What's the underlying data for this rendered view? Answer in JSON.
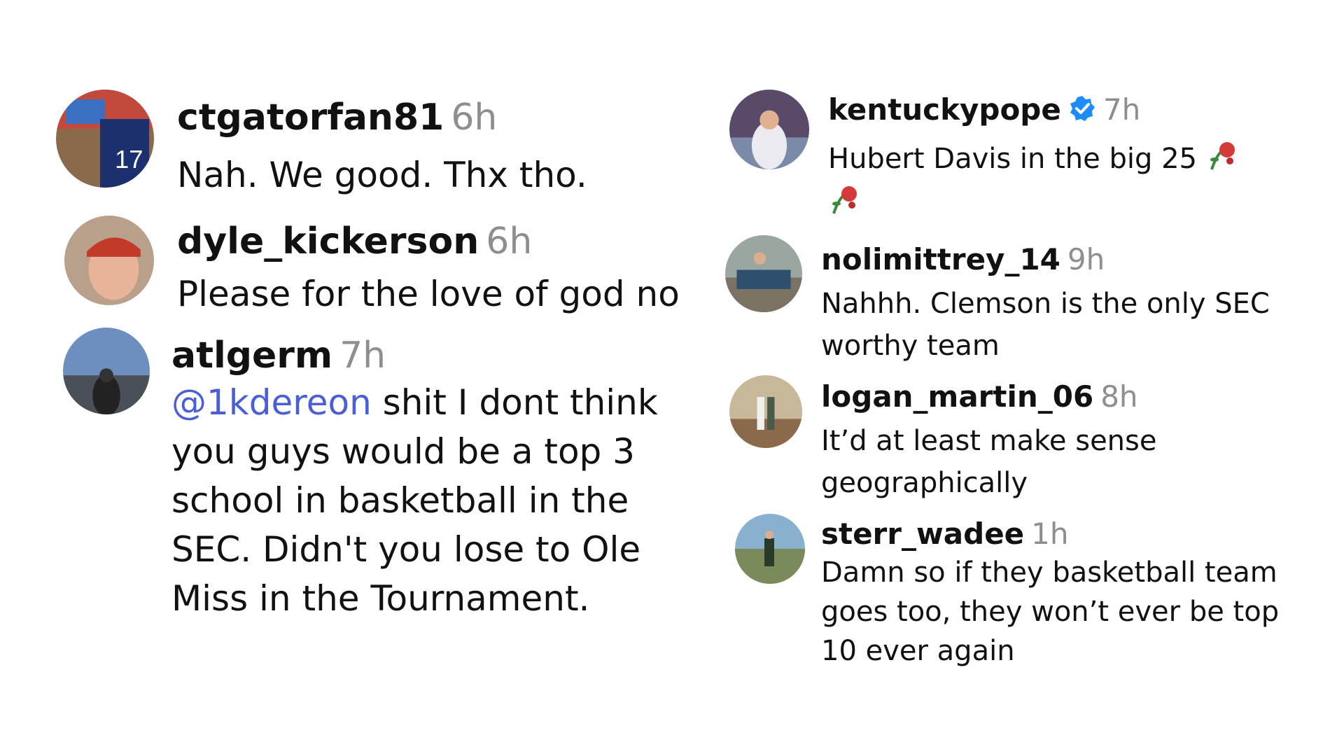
{
  "comments": [
    {
      "username": "ctgatorfan81",
      "time": "6h",
      "text": "Nah. We good. Thx tho."
    },
    {
      "username": "dyle_kickerson",
      "time": "6h",
      "text": "Please for the love of god no"
    },
    {
      "username": "atlgerm",
      "time": "7h",
      "mention": "@1kdereon",
      "text": " shit I dont think you guys would be a top 3 school in basketball in the SEC. Didn't you lose to Ole Miss in the Tournament."
    },
    {
      "username": "kentuckypope",
      "time": "7h",
      "verified": true,
      "text": "Hubert Davis in the big 25 ",
      "emoji": "rose-wilted-icon"
    },
    {
      "username": "nolimittrey_14",
      "time": "9h",
      "text": "Nahhh. Clemson is the only SEC worthy team"
    },
    {
      "username": "logan_martin_06",
      "time": "8h",
      "text": "It’d at least make sense geographically"
    },
    {
      "username": "sterr_wadee",
      "time": "1h",
      "text": "Damn so if they basketball team goes too, they won’t ever be top 10 ever again"
    }
  ],
  "colors": {
    "text": "#111111",
    "time": "#8e8e8e",
    "mention": "#4a5fd6",
    "verified": "#1d8cf8"
  }
}
